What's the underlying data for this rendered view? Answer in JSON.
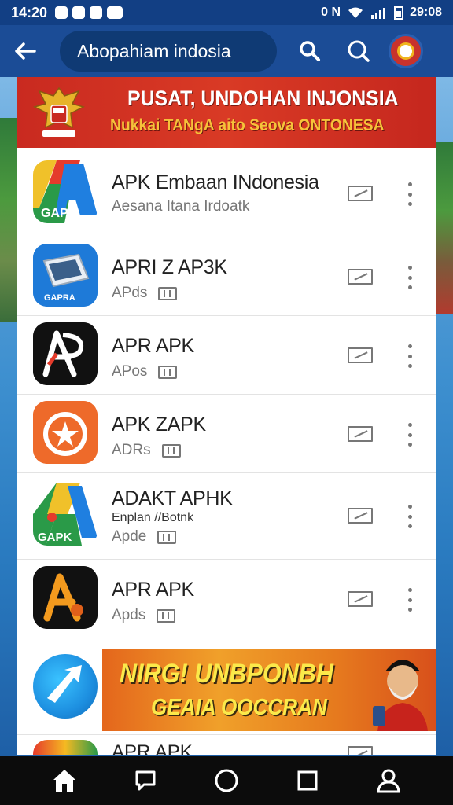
{
  "status_bar": {
    "time": "14:20",
    "network": "0 N",
    "battery_time": "29:08"
  },
  "app_bar": {
    "search_text": "Abopahiam indosia"
  },
  "banner": {
    "title": "PUSAT, UNDOHAN INJONSIA",
    "subtitle": "Nukkai TANgA aito Seova ONTONESA"
  },
  "apps": [
    {
      "name": "APK Embaan INdonesia",
      "sub": "Aesana Itana Irdoatk",
      "icon": "apk-a-icon",
      "colors": [
        "#f0c12a",
        "#e53b2b",
        "#2a9a48",
        "#1f7fe0"
      ]
    },
    {
      "name": "APRI Z AP3K",
      "sub": "APds",
      "icon": "device-icon",
      "colors": [
        "#1e7ad8"
      ]
    },
    {
      "name": "APR APK",
      "sub": "APos",
      "icon": "a-logo-icon",
      "colors": [
        "#111111"
      ]
    },
    {
      "name": "APK ZAPK",
      "sub": "ADRs",
      "icon": "star-icon",
      "colors": [
        "#ee6a2a"
      ]
    },
    {
      "name": "ADAKT APHK",
      "sub": "Apde",
      "sub2": "Enplan //Botnk",
      "icon": "apk-a-icon-2",
      "colors": [
        "#2a9a48",
        "#e53b2b",
        "#f0c12a",
        "#1f7fe0"
      ]
    },
    {
      "name": "APR APK",
      "sub": "Apds",
      "icon": "a-logo-orange-icon",
      "colors": [
        "#111111",
        "#f39a1e"
      ]
    }
  ],
  "promo": {
    "title": "NIRG! UNBPONBH",
    "subtitle": "GEAIA OOCCRAN"
  },
  "cut_row": {
    "name": "APR APK"
  },
  "nav": [
    "home",
    "chat",
    "circle",
    "square",
    "person"
  ]
}
